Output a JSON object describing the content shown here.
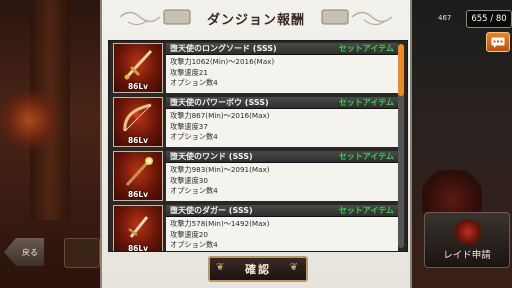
{
  "modal": {
    "title": "ダンジョン報酬",
    "confirm_label": "確認"
  },
  "items": [
    {
      "name": "堕天使のロングソード (SSS)",
      "set_tag": "セットアイテム",
      "level": "86Lv",
      "attack_power": "攻撃力1062(Min)〜2016(Max)",
      "attack_speed": "攻撃速度21",
      "options": "オプション数4"
    },
    {
      "name": "堕天使のパワーボウ (SSS)",
      "set_tag": "セットアイテム",
      "level": "86Lv",
      "attack_power": "攻撃力867(Min)〜2016(Max)",
      "attack_speed": "攻撃速度37",
      "options": "オプション数4"
    },
    {
      "name": "堕天使のワンド (SSS)",
      "set_tag": "セットアイテム",
      "level": "86Lv",
      "attack_power": "攻撃力983(Min)〜2091(Max)",
      "attack_speed": "攻撃速度30",
      "options": "オプション数4"
    },
    {
      "name": "堕天使のダガー (SSS)",
      "set_tag": "セットアイテム",
      "level": "86Lv",
      "attack_power": "攻撃力578(Min)〜1492(Max)",
      "attack_speed": "攻撃速度20",
      "options": "オプション数4"
    }
  ],
  "hud": {
    "counter_small": "467",
    "counter": "655 / 80",
    "back_label": "戻る",
    "left_chip_label": "",
    "raid_label": "レイド申請"
  },
  "scroll_position": 0.0,
  "colors": {
    "set_tag": "#3ad04a",
    "accent": "#e8892a"
  },
  "icons": [
    "chat-icon",
    "sword-icon",
    "bow-icon",
    "wand-icon",
    "dagger-icon"
  ]
}
